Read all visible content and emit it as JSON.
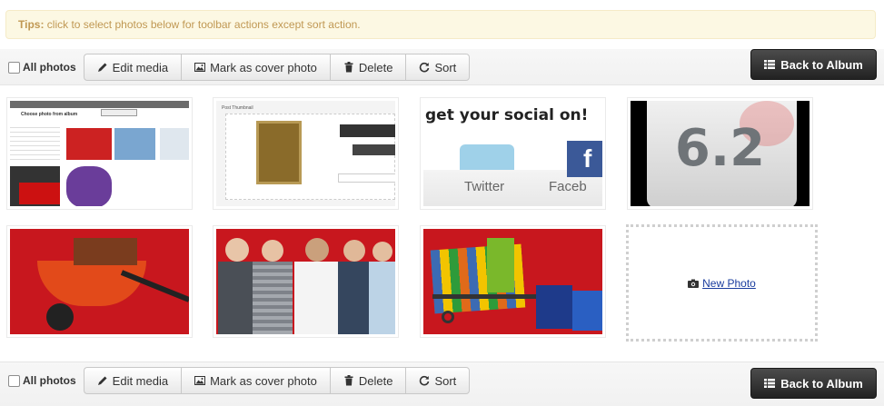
{
  "tips": {
    "label": "Tips:",
    "text": " click to select photos below for toolbar actions except sort action."
  },
  "toolbar_top": {
    "all_photos": "All photos",
    "buttons": [
      "Edit media",
      "Mark as cover photo",
      "Delete",
      "Sort"
    ],
    "back": "Back to Album"
  },
  "toolbar_bottom": {
    "all_photos": "All photos",
    "buttons": [
      "Edit media",
      "Mark as cover photo",
      "Delete",
      "Sort"
    ],
    "back": "Back to Album"
  },
  "photos": [
    {
      "caption": "Choose photo from album"
    },
    {
      "caption": "Post Thumbnail"
    },
    {
      "caption": "get your social on!",
      "sub1": "Twitter",
      "sub2": "Faceb"
    },
    {
      "caption": "6.2"
    },
    {
      "caption": ""
    },
    {
      "caption": ""
    },
    {
      "caption": ""
    }
  ],
  "new_photo": "New Photo",
  "colors": {
    "tips_bg": "#fcf8e3",
    "tips_text": "#c09853",
    "back_btn": "#333333"
  }
}
